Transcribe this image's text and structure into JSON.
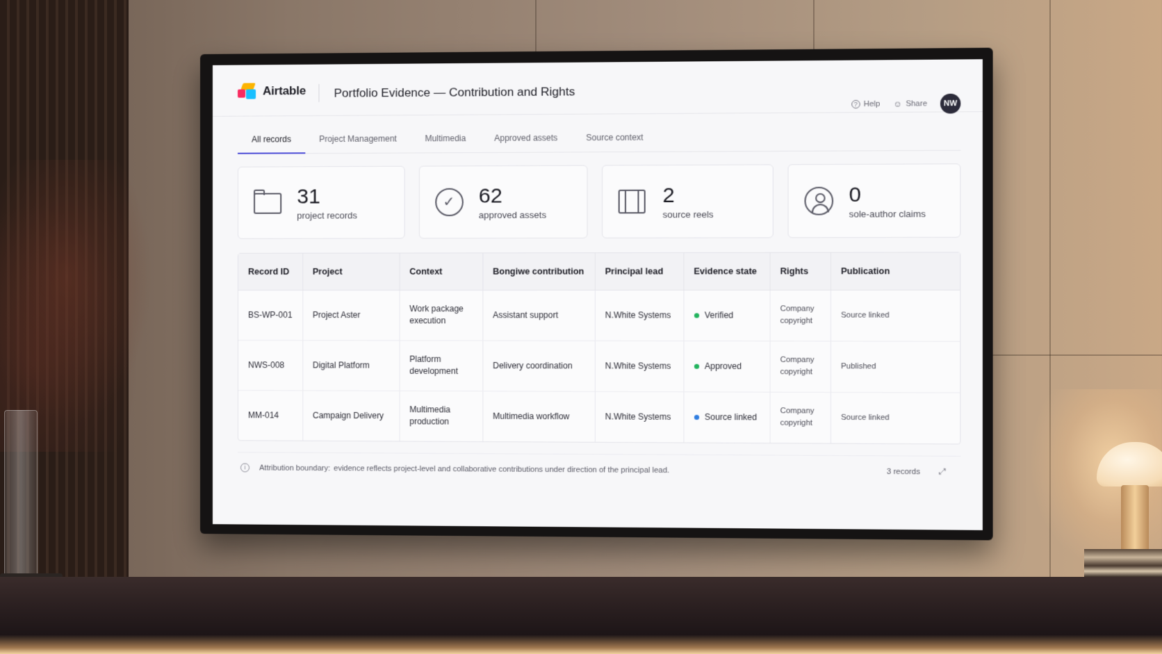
{
  "app": {
    "name": "Airtable",
    "page_title": "Portfolio Evidence — Contribution and Rights"
  },
  "header_actions": {
    "help": "Help",
    "share": "Share",
    "avatar_initials": "NW"
  },
  "tabs": [
    {
      "label": "All records",
      "active": true
    },
    {
      "label": "Project Management",
      "active": false
    },
    {
      "label": "Multimedia",
      "active": false
    },
    {
      "label": "Approved assets",
      "active": false
    },
    {
      "label": "Source context",
      "active": false
    }
  ],
  "stats": [
    {
      "icon": "folder-icon",
      "value": "31",
      "label": "project records"
    },
    {
      "icon": "check-circle-icon",
      "value": "62",
      "label": "approved assets"
    },
    {
      "icon": "film-icon",
      "value": "2",
      "label": "source reels"
    },
    {
      "icon": "user-circle-icon",
      "value": "0",
      "label": "sole-author claims"
    }
  ],
  "table": {
    "columns": [
      "Record ID",
      "Project",
      "Context",
      "Bongiwe contribution",
      "Principal lead",
      "Evidence state",
      "Rights",
      "Publication"
    ],
    "rows": [
      {
        "record_id": "BS-WP-001",
        "project": "Project Aster",
        "context": "Work package execution",
        "contribution": "Assistant support",
        "lead": "N.White Systems",
        "state": "Verified",
        "state_color": "#22b35e",
        "rights": "Company copyright",
        "publication": "Source linked"
      },
      {
        "record_id": "NWS-008",
        "project": "Digital Platform",
        "context": "Platform development",
        "contribution": "Delivery coordination",
        "lead": "N.White Systems",
        "state": "Approved",
        "state_color": "#22b35e",
        "rights": "Company copyright",
        "publication": "Published"
      },
      {
        "record_id": "MM-014",
        "project": "Campaign Delivery",
        "context": "Multimedia production",
        "contribution": "Multimedia workflow",
        "lead": "N.White Systems",
        "state": "Source linked",
        "state_color": "#2f7de0",
        "rights": "Company copyright",
        "publication": "Source linked"
      }
    ]
  },
  "footer": {
    "note_label": "Attribution boundary:",
    "note_text": "evidence reflects project-level and collaborative contributions under direction of the principal lead.",
    "record_count": "3 records"
  }
}
